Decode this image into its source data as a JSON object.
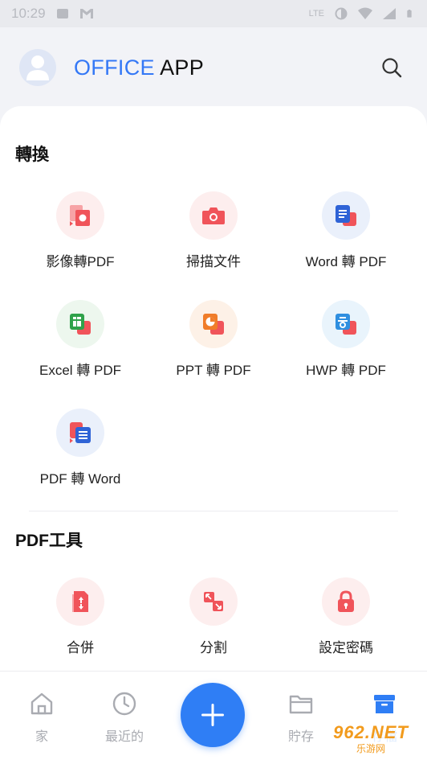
{
  "status_bar": {
    "time": "10:29",
    "network": "LTE"
  },
  "header": {
    "title_part1": "OFFICE",
    "title_part2": "APP"
  },
  "sections": {
    "convert": {
      "title": "轉換",
      "items": [
        {
          "label": "影像轉PDF",
          "icon": "image-to-pdf-icon"
        },
        {
          "label": "掃描文件",
          "icon": "camera-icon"
        },
        {
          "label": "Word 轉 PDF",
          "icon": "word-to-pdf-icon"
        },
        {
          "label": "Excel 轉 PDF",
          "icon": "excel-to-pdf-icon"
        },
        {
          "label": "PPT 轉 PDF",
          "icon": "ppt-to-pdf-icon"
        },
        {
          "label": "HWP 轉 PDF",
          "icon": "hwp-to-pdf-icon"
        },
        {
          "label": "PDF 轉 Word",
          "icon": "pdf-to-word-icon"
        }
      ]
    },
    "pdf_tools": {
      "title": "PDF工具",
      "items": [
        {
          "label": "合併",
          "icon": "merge-icon"
        },
        {
          "label": "分割",
          "icon": "split-icon"
        },
        {
          "label": "設定密碼",
          "icon": "lock-icon"
        }
      ]
    }
  },
  "bottom_nav": {
    "home": "家",
    "recent": "最近的",
    "storage": "貯存",
    "archive": "存檔"
  },
  "watermark": {
    "brand": "962.NET",
    "sub": "乐游网"
  },
  "colors": {
    "accent": "#3478f6",
    "fab": "#2f7ef5",
    "red": "#f0545a",
    "word_blue": "#2f63d6",
    "excel_green": "#2fa24a",
    "ppt_orange": "#f07d2a",
    "hwp_blue": "#2f8fe0"
  }
}
